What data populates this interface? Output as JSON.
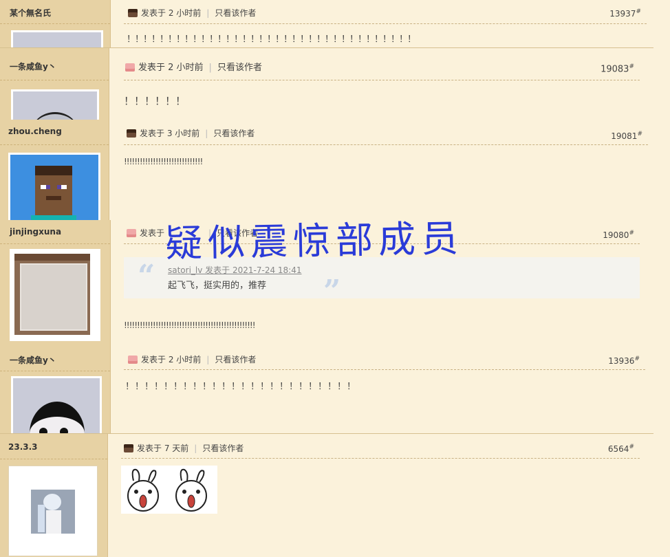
{
  "posts": [
    {
      "user": "某个無名氏",
      "meta_posted": "发表于 2 小时前",
      "meta_author_only": "只看该作者",
      "floor": "13937",
      "floor_mark": "#",
      "body": "！！！！！！！！！！！！！！！！！！！！！！！！！！！！！！！！！！！"
    },
    {
      "user": "一条咸鱼y丶",
      "meta_posted": "发表于 2 小时前",
      "meta_author_only": "只看该作者",
      "floor": "19083",
      "floor_mark": "#",
      "body": "！！！！！！"
    },
    {
      "user": "zhou.cheng",
      "meta_posted": "发表于 3 小时前",
      "meta_author_only": "只看该作者",
      "floor": "19081",
      "floor_mark": "#",
      "body": "!!!!!!!!!!!!!!!!!!!!!!!!!!!!!!"
    },
    {
      "user": "jinjingxuna",
      "meta_posted": "发表于",
      "meta_author_only": "只看该作者",
      "floor": "19080",
      "floor_mark": "#",
      "quote_author": "satori_lv 发表于 2021-7-24 18:41",
      "quote_text": "起飞飞，挺实用的，推荐",
      "body": "!!!!!!!!!!!!!!!!!!!!!!!!!!!!!!!!!!!!!!!!!!!!!!!!!!"
    },
    {
      "user": "一条咸鱼y丶",
      "meta_posted": "发表于 2 小时前",
      "meta_author_only": "只看该作者",
      "floor": "13936",
      "floor_mark": "#",
      "body": "！！！！！！！！！！！！！！！！！！！！！！！！"
    },
    {
      "user": "23.3.3",
      "meta_posted": "发表于 7 天前",
      "meta_author_only": "只看该作者",
      "floor": "6564",
      "floor_mark": "#"
    }
  ],
  "overlay_text": "疑似震惊部成员",
  "colors": {
    "sidebar": "#e7d2a4",
    "background": "#fbf2db",
    "overlay": "#2a3bd8"
  }
}
